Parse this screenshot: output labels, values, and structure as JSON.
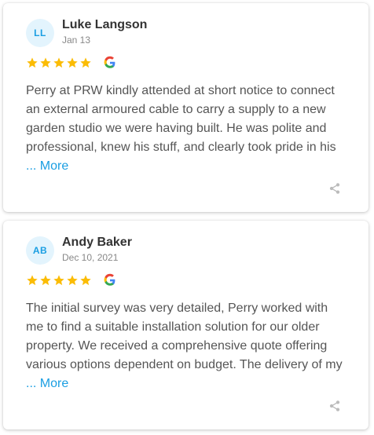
{
  "reviews": [
    {
      "initials": "LL",
      "name": "Luke Langson",
      "date": "Jan 13",
      "rating": 5,
      "text": "Perry at PRW kindly attended at short notice to connect an external armoured cable to carry a supply to a new garden studio we were having built. He was polite and professional, knew his stuff, and clearly took pride in his",
      "more_label": "... More"
    },
    {
      "initials": "AB",
      "name": "Andy Baker",
      "date": "Dec 10, 2021",
      "rating": 5,
      "text": "The initial survey was very detailed, Perry worked with me to find a suitable installation solution for our older property. We received a comprehensive quote offering various options dependent on budget. The delivery of my",
      "more_label": "... More"
    }
  ],
  "icons": {
    "star": "star-icon",
    "source": "google-g-icon",
    "share": "share-icon"
  },
  "colors": {
    "star": "#fbbc05",
    "accent": "#1a9ee2",
    "avatar_bg": "#e3f4fd",
    "share": "#bbbbbb"
  }
}
